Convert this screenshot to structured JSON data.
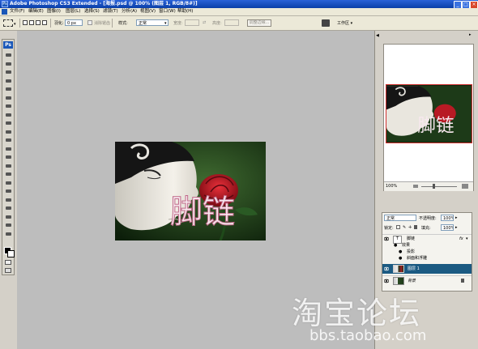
{
  "window": {
    "title": "Adobe Photoshop CS3 Extended - [海报.psd @ 100% (图层 1, RGB/8#)]",
    "controls": [
      "_",
      "□",
      "×"
    ]
  },
  "menu": {
    "items": [
      "文件(F)",
      "编辑(E)",
      "图像(I)",
      "图层(L)",
      "选择(S)",
      "滤镜(T)",
      "分析(A)",
      "视图(V)",
      "窗口(W)",
      "帮助(H)"
    ]
  },
  "options_bar": {
    "feather_label": "羽化:",
    "feather_value": "0 px",
    "antialias_label": "消除锯齿",
    "style_label": "样式:",
    "style_value": "正常",
    "width_label": "宽度:",
    "height_label": "高度:",
    "refine_edge_label": "调整边缘...",
    "workspace_label": "工作区 ▾"
  },
  "toolbox": {
    "logo": "Ps"
  },
  "document": {
    "text": "脚链"
  },
  "navigator": {
    "zoom": "100%"
  },
  "layers": {
    "blend_mode": "正常",
    "opacity_label": "不透明度:",
    "opacity_value": "100%",
    "lock_label": "锁定:",
    "fill_label": "填充:",
    "fill_value": "100%",
    "items": [
      {
        "name": "脚链",
        "kind": "text",
        "has_fx": true,
        "fx_marker": "fx",
        "selected": false
      },
      {
        "name": "图层 1",
        "kind": "image",
        "selected": true
      },
      {
        "name": "背景",
        "kind": "background",
        "selected": false
      }
    ],
    "effects_header": "效果",
    "effects": [
      "投影",
      "斜面和浮雕"
    ]
  },
  "watermark": {
    "logo_text": "淘宝论坛",
    "url": "bbs.taobao.com"
  },
  "colors": {
    "titlebar": "#0a3fa8",
    "workspace_bg": "#bdbdbd",
    "selected_layer": "#1b5a82",
    "nav_frame": "#d03030"
  }
}
